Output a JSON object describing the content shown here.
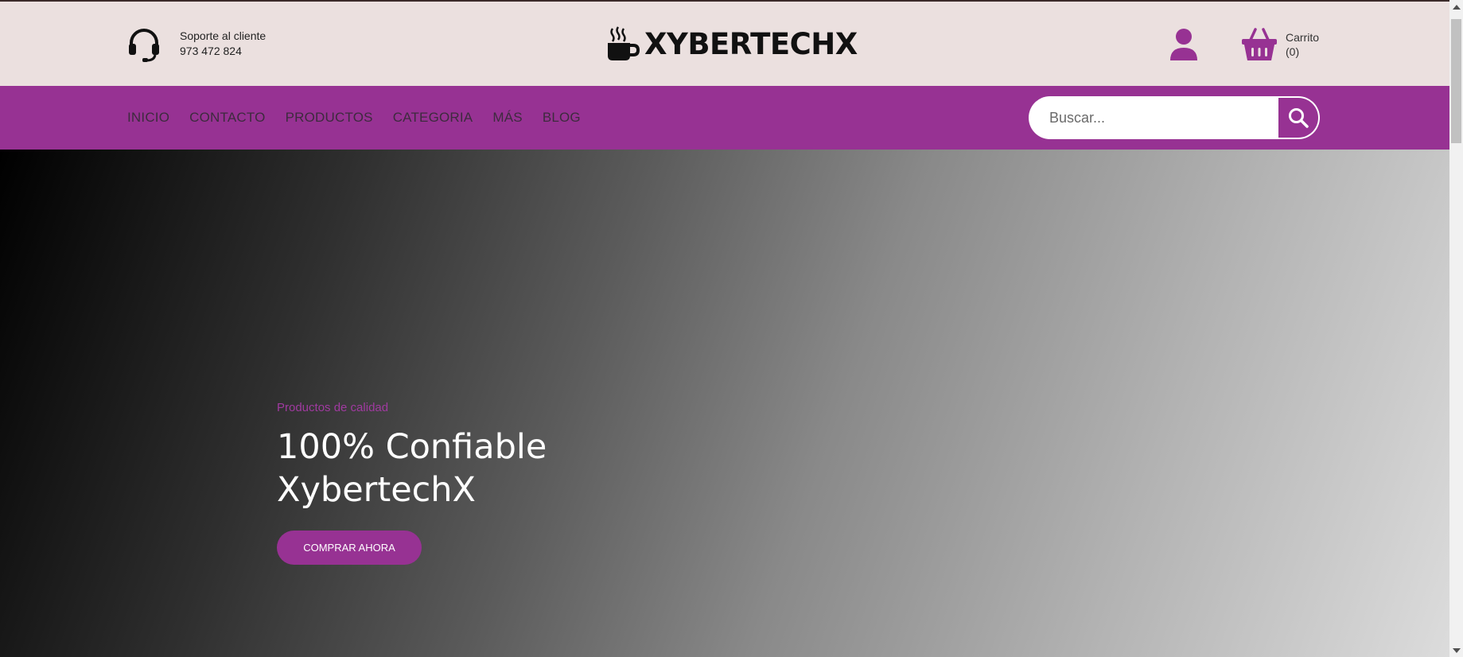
{
  "header": {
    "support": {
      "label": "Soporte al cliente",
      "phone": "973 472 824",
      "icon": "headset-icon"
    },
    "logo": {
      "text": "XYBERTECHX",
      "icon": "coffee-cup-icon"
    },
    "user": {
      "icon": "user-icon"
    },
    "cart": {
      "label": "Carrito",
      "count": "(0)",
      "icon": "basket-icon"
    }
  },
  "nav": {
    "items": [
      {
        "label": "INICIO"
      },
      {
        "label": "CONTACTO"
      },
      {
        "label": "PRODUCTOS"
      },
      {
        "label": "CATEGORIA"
      },
      {
        "label": "MÁS"
      },
      {
        "label": "BLOG"
      }
    ]
  },
  "search": {
    "placeholder": "Buscar...",
    "value": "",
    "icon": "search-icon"
  },
  "hero": {
    "eyebrow": "Productos de calidad",
    "title_line1": "100% Confiable",
    "title_line2": "XybertechX",
    "cta": "COMPRAR AHORA"
  },
  "colors": {
    "brand": "#973293",
    "header_bg": "#ebe0df",
    "nav_text": "#3d2b3e"
  }
}
